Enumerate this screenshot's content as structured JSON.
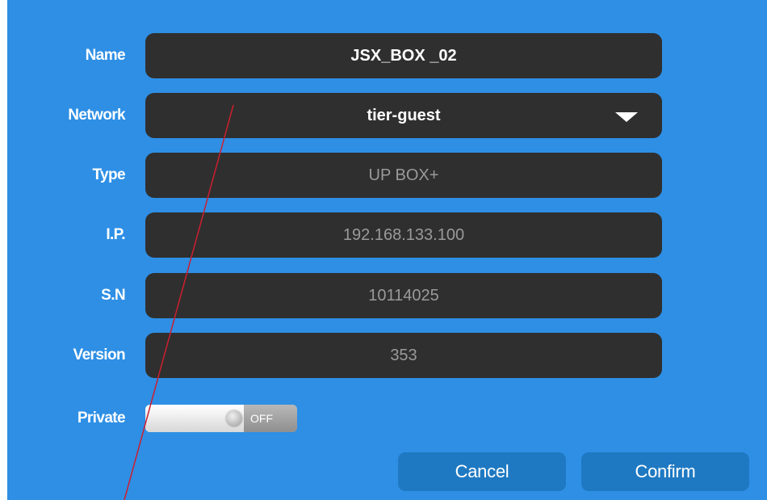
{
  "form": {
    "name": {
      "label": "Name",
      "value": "JSX_BOX _02"
    },
    "network": {
      "label": "Network",
      "value": "tier-guest",
      "icon": "chevron-down-icon"
    },
    "type": {
      "label": "Type",
      "value": "UP BOX+"
    },
    "ip": {
      "label": "I.P.",
      "value": "192.168.133.100"
    },
    "sn": {
      "label": "S.N",
      "value": "10114025"
    },
    "version": {
      "label": "Version",
      "value": "353"
    },
    "private": {
      "label": "Private",
      "state": "OFF"
    }
  },
  "buttons": {
    "cancel": "Cancel",
    "confirm": "Confirm"
  },
  "colors": {
    "panel_background": "#2e8fe5",
    "field_background": "#2f2f2f",
    "button_background": "#1f79c2",
    "annotation_line": "#cc1f2f"
  }
}
